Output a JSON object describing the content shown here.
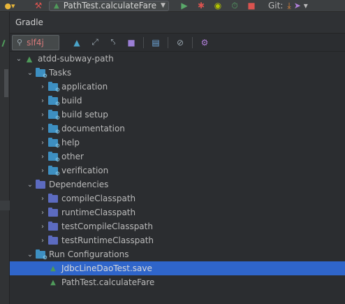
{
  "topbar": {
    "run_config_label": "PathTest.calculateFare",
    "git_label": "Git:"
  },
  "panel": {
    "title": "Gradle",
    "search_query": "slf4j"
  },
  "tree": {
    "root": {
      "label": "atdd-subway-path"
    },
    "tasks": {
      "label": "Tasks",
      "children": [
        "application",
        "build",
        "build setup",
        "documentation",
        "help",
        "other",
        "verification"
      ]
    },
    "dependencies": {
      "label": "Dependencies",
      "children": [
        "compileClasspath",
        "runtimeClasspath",
        "testCompileClasspath",
        "testRuntimeClasspath"
      ]
    },
    "run_configurations": {
      "label": "Run Configurations",
      "children": [
        "JdbcLineDaoTest.save",
        "PathTest.calculateFare"
      ],
      "selected_index": 0
    }
  },
  "colors": {
    "selection": "#2f65ca",
    "tasks_folder": "#3d8fc1",
    "dependencies_folder": "#5c6bc0",
    "gradle_green": "#4f9a5a"
  }
}
